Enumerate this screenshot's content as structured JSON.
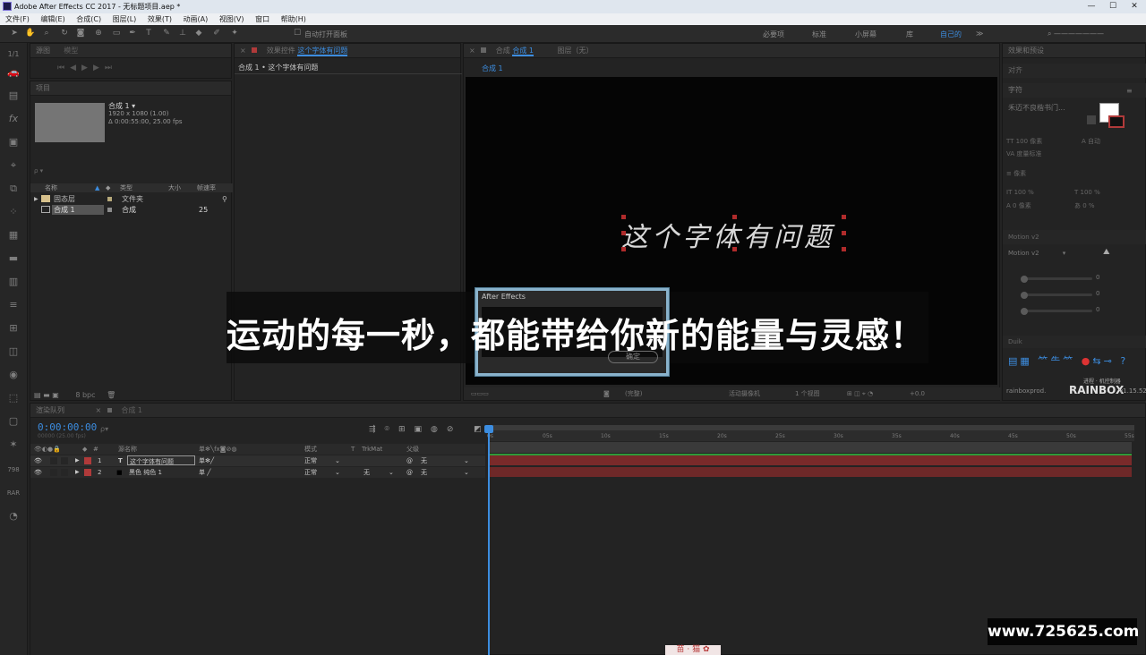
{
  "window": {
    "title": "Adobe After Effects CC 2017 - 无标题项目.aep *",
    "min_glyph": "—",
    "max_glyph": "☐",
    "close_glyph": "✕"
  },
  "menu": [
    "文件(F)",
    "编辑(E)",
    "合成(C)",
    "图层(L)",
    "效果(T)",
    "动画(A)",
    "视图(V)",
    "窗口",
    "帮助(H)"
  ],
  "toolbar": {
    "snap_label": "自动打开面板",
    "workspaces": [
      "必要项",
      "标准",
      "小屏幕",
      "库",
      "自己的"
    ],
    "active_workspace": "自己的"
  },
  "effects_panel": {
    "tab1": "源图",
    "tab2": "模型"
  },
  "project_panel": {
    "tab": "项目",
    "comp_name": "合成 1 ▾",
    "comp_res": "1920 x 1080 (1.00)",
    "comp_dur": "Δ 0:00:55:00, 25.00 fps",
    "search_placeholder": "ρ ▾",
    "columns": [
      "名称",
      "类型",
      "大小",
      "帧速率"
    ],
    "rows": [
      {
        "name": "固态层",
        "type": "文件夹",
        "size": "",
        "fps": ""
      },
      {
        "name": "合成 1",
        "type": "合成",
        "size": "",
        "fps": "25"
      }
    ],
    "bpc": "8 bpc"
  },
  "effect_controls": {
    "tab_prefix": "效果控件",
    "tab_name": "这个字体有问题",
    "path": "合成 1 • 这个字体有问题"
  },
  "composition": {
    "tab_prefix": "合成",
    "tab_name": "合成 1",
    "layer_tab": "图层（无）",
    "breadcrumb": "合成 1",
    "handwriting_text": "这个字体有问题",
    "zoom_label": "(完整)",
    "active_camera": "活动摄像机",
    "views": "1 个视图",
    "exposure": "+0.0"
  },
  "caption": "运动的每一秒，都能带给你新的能量与灵感！",
  "dialog": {
    "title": "After Effects",
    "ok_label": "确定"
  },
  "right_panels": {
    "effects_presets": "效果和预设",
    "align": "对齐",
    "character": "字符",
    "font_placeholder": "禾迈不良楷书门...",
    "px_size": "100 像素",
    "px_tracking": "度量标准",
    "px_leading": "自动",
    "lines": "像素",
    "scale_v": "100 %",
    "scale_h": "100 %",
    "baseline": "0 像素",
    "tsume": "0 %",
    "motion_tab": "Motion v2",
    "motion_select": "Motion v2",
    "slider_values": [
      "0",
      "0",
      "0"
    ],
    "rainbox_site": "rainboxprod.",
    "rainbox_brand": "RAINBOX",
    "rainbox_sub": "进程 · 机控制器",
    "version": "v1.15.52",
    "duik_tab": "Duik"
  },
  "timeline": {
    "tab_queue": "渲染队列",
    "tab_comp": "合成 1",
    "timecode": "0:00:00:00",
    "fps_sub": "00000 (25.00 fps)",
    "search_placeholder": "ρ▾",
    "col_source": "源名称",
    "col_mode": "模式",
    "col_t": "T",
    "col_trkmat": "TrkMat",
    "col_parent": "父级",
    "layers": [
      {
        "num": "1",
        "type": "T",
        "name": "这个字体有问题",
        "mode": "正常",
        "trkmat": "",
        "parent": "无",
        "color": "#b03a3a"
      },
      {
        "num": "2",
        "type": "■",
        "name": "黑色 纯色 1",
        "mode": "正常",
        "trkmat": "无",
        "parent": "无",
        "color": "#b03a3a"
      }
    ],
    "ruler": [
      "0s",
      "05s",
      "10s",
      "15s",
      "20s",
      "25s",
      "30s",
      "35s",
      "40s",
      "45s",
      "50s",
      "55s"
    ]
  },
  "watermark": "www.725625.com",
  "badge": "苗 · 猫 ✿",
  "colors": {
    "accent": "#3c8de0",
    "layer_bar": "#7a2a2a",
    "dialog_border": "#8ab3cc"
  }
}
